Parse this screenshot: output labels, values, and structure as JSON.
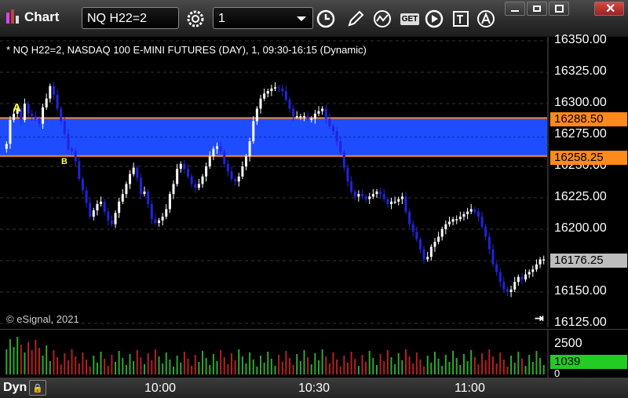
{
  "window": {
    "title": "Chart"
  },
  "toolbar": {
    "symbol": "NQ H22=2",
    "interval": "1",
    "get_label": "GET"
  },
  "chart_header": "* NQ H22=2, NASDAQ 100 E-MINI FUTURES (DAY), 1, 09:30-16:15 (Dynamic)",
  "copyright": "© eSignal, 2021",
  "price_axis": [
    "16350.00",
    "16325.00",
    "16300.00",
    "16275.00",
    "16250.00",
    "16225.00",
    "16200.00",
    "16175.00",
    "16150.00",
    "16125.00"
  ],
  "volume_axis": [
    "2500",
    "0"
  ],
  "zone": {
    "upper": "16288.50",
    "lower": "16258.25",
    "color": "#1e4dff",
    "line_color": "#ff8a1c"
  },
  "last_price": "16176.25",
  "last_volume": "1039",
  "markers": {
    "a": "A",
    "b": "B"
  },
  "timebar": {
    "mode": "Dyn",
    "times": [
      "10:00",
      "10:30",
      "11:00"
    ]
  },
  "colors": {
    "up": "#ffffff",
    "down": "#2222dd",
    "vol_up": "#2ea82e",
    "vol_down": "#b52020",
    "last_price_bg": "#bdbdbd",
    "last_vol_bg": "#22cc22"
  },
  "chart_data": {
    "type": "candlestick",
    "title": "NQ H22=2, NASDAQ 100 E-MINI FUTURES (DAY), 1, 09:30-16:15 (Dynamic)",
    "ylim": [
      16125,
      16355
    ],
    "x_ticks": [
      "10:00",
      "10:30",
      "11:00"
    ],
    "zone": [
      16258.25,
      16288.5
    ],
    "last": 16176.25,
    "close": [
      16268,
      16287,
      16292,
      16296,
      16287,
      16300,
      16292,
      16290,
      16288,
      16284,
      16297,
      16304,
      16314,
      16307,
      16296,
      16286,
      16276,
      16264,
      16262,
      16254,
      16240,
      16231,
      16221,
      16210,
      16215,
      16220,
      16222,
      16214,
      16207,
      16204,
      16213,
      16222,
      16228,
      16236,
      16244,
      16249,
      16241,
      16228,
      16230,
      16220,
      16208,
      16205,
      16207,
      16210,
      16216,
      16228,
      16236,
      16248,
      16252,
      16248,
      16242,
      16236,
      16233,
      16236,
      16242,
      16250,
      16258,
      16264,
      16266,
      16262,
      16252,
      16246,
      16240,
      16238,
      16242,
      16250,
      16258,
      16270,
      16286,
      16296,
      16304,
      16308,
      16310,
      16312,
      16313,
      16312,
      16310,
      16303,
      16296,
      16290,
      16290,
      16290,
      16290,
      16288,
      16288,
      16292,
      16294,
      16296,
      16288,
      16282,
      16278,
      16270,
      16261,
      16249,
      16238,
      16230,
      16226,
      16228,
      16226,
      16224,
      16226,
      16228,
      16230,
      16228,
      16224,
      16220,
      16222,
      16222,
      16224,
      16226,
      16214,
      16204,
      16198,
      16192,
      16184,
      16176,
      16178,
      16186,
      16190,
      16194,
      16200,
      16204,
      16206,
      16208,
      16208,
      16210,
      16212,
      16214,
      16216,
      16214,
      16210,
      16202,
      16194,
      16184,
      16172,
      16166,
      16158,
      16152,
      16150,
      16152,
      16158,
      16162,
      16160,
      16164,
      16166,
      16168,
      16172,
      16176,
      16176
    ]
  }
}
